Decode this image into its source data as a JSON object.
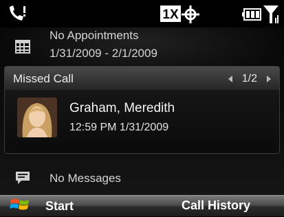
{
  "status_bar": {
    "network_label": "1X",
    "icons": [
      "phone-missed-call-icon",
      "data-1x-icon",
      "roaming-icon",
      "battery-icon",
      "signal-icon"
    ]
  },
  "appointments": {
    "title": "No Appointments",
    "date_range": "1/31/2009 - 2/1/2009",
    "icon": "calendar-icon"
  },
  "missed_call": {
    "header": "Missed Call",
    "pager": "1/2",
    "caller_name": "Graham, Meredith",
    "time": "12:59 PM 1/31/2009"
  },
  "messages": {
    "text": "No Messages",
    "icon": "message-icon"
  },
  "softkeys": {
    "left": "Start",
    "right": "Call History"
  },
  "colors": {
    "background": "#000000",
    "card_header": "#3a3a3a",
    "text_primary": "#ffffff",
    "text_secondary": "#d5d5d5"
  }
}
